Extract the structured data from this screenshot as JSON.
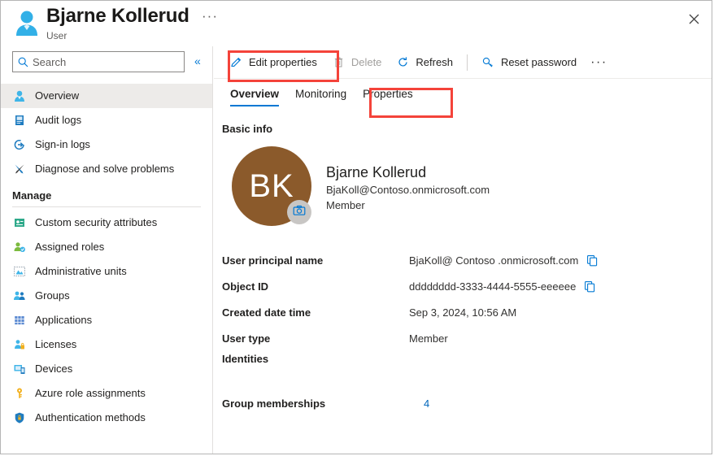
{
  "header": {
    "title": "Bjarne Kollerud",
    "subtitle": "User",
    "user_icon": "user-avatar-icon",
    "ellipsis": "···",
    "close_icon": "close-icon"
  },
  "sidebar": {
    "search": {
      "placeholder": "Search",
      "value": "",
      "icon": "search-icon"
    },
    "collapse_icon": "«",
    "items": [
      {
        "label": "Overview",
        "icon": "user-icon",
        "selected": true
      },
      {
        "label": "Audit logs",
        "icon": "audit-log-icon",
        "selected": false
      },
      {
        "label": "Sign-in logs",
        "icon": "sign-in-icon",
        "selected": false
      },
      {
        "label": "Diagnose and solve problems",
        "icon": "wrench-screwdriver-icon",
        "selected": false
      }
    ],
    "group_label": "Manage",
    "manage_items": [
      {
        "label": "Custom security attributes",
        "icon": "security-attribute-icon"
      },
      {
        "label": "Assigned roles",
        "icon": "assigned-roles-icon"
      },
      {
        "label": "Administrative units",
        "icon": "administrative-units-icon"
      },
      {
        "label": "Groups",
        "icon": "groups-icon"
      },
      {
        "label": "Applications",
        "icon": "applications-grid-icon"
      },
      {
        "label": "Licenses",
        "icon": "licenses-icon"
      },
      {
        "label": "Devices",
        "icon": "devices-icon"
      },
      {
        "label": "Azure role assignments",
        "icon": "key-icon"
      },
      {
        "label": "Authentication methods",
        "icon": "shield-lock-icon"
      }
    ]
  },
  "toolbar": {
    "edit_properties": "Edit properties",
    "delete": "Delete",
    "refresh": "Refresh",
    "reset_password": "Reset password",
    "ellipsis": "···",
    "icons": {
      "edit": "pencil-icon",
      "delete": "trash-icon",
      "refresh": "refresh-icon",
      "reset_password": "key-search-icon"
    }
  },
  "tabs": [
    {
      "label": "Overview",
      "active": true
    },
    {
      "label": "Monitoring",
      "active": false
    },
    {
      "label": "Properties",
      "active": false
    }
  ],
  "main": {
    "section_title": "Basic info",
    "avatar": {
      "initials": "BK",
      "background": "#8b5a2b",
      "camera_icon": "camera-icon"
    },
    "identity": {
      "name": "Bjarne Kollerud",
      "upn": "BjaKoll@Contoso.onmicrosoft.com",
      "user_type": "Member"
    },
    "properties": [
      {
        "label": "User principal name",
        "value": "BjaKoll@ Contoso .onmicrosoft.com",
        "copy": true,
        "copy_icon": "copy-icon"
      },
      {
        "label": "Object ID",
        "value": "dddddddd-3333-4444-5555-eeeeee",
        "copy": true,
        "copy_icon": "copy-icon"
      },
      {
        "label": "Created date time",
        "value": "Sep 3, 2024, 10:56 AM",
        "copy": false
      },
      {
        "label": "User type",
        "value": "Member",
        "copy": false
      },
      {
        "label": "Identities",
        "value": "",
        "copy": false
      }
    ],
    "group_memberships": {
      "label": "Group memberships",
      "count": "4"
    }
  },
  "annotations": {
    "highlight_color": "#f4433a",
    "boxes": [
      {
        "target": "edit-properties-button"
      },
      {
        "target": "tab-properties"
      }
    ]
  }
}
